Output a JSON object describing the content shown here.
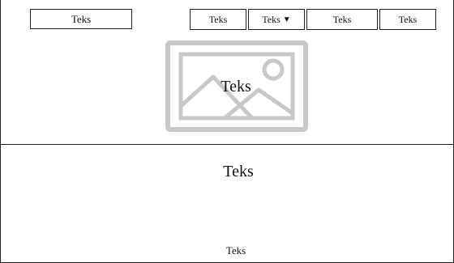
{
  "header": {
    "logo_label": "Teks",
    "nav": [
      {
        "label": "Teks"
      },
      {
        "label": "Teks",
        "has_dropdown": true
      },
      {
        "label": "Teks"
      },
      {
        "label": "Teks"
      }
    ],
    "hero_image_icon": "image-placeholder-icon",
    "hero_text": "Teks"
  },
  "main": {
    "title": "Teks"
  },
  "footer": {
    "text": "Teks"
  },
  "colors": {
    "border": "#222222",
    "placeholder_icon": "#c8c8c8",
    "background": "#ffffff"
  }
}
